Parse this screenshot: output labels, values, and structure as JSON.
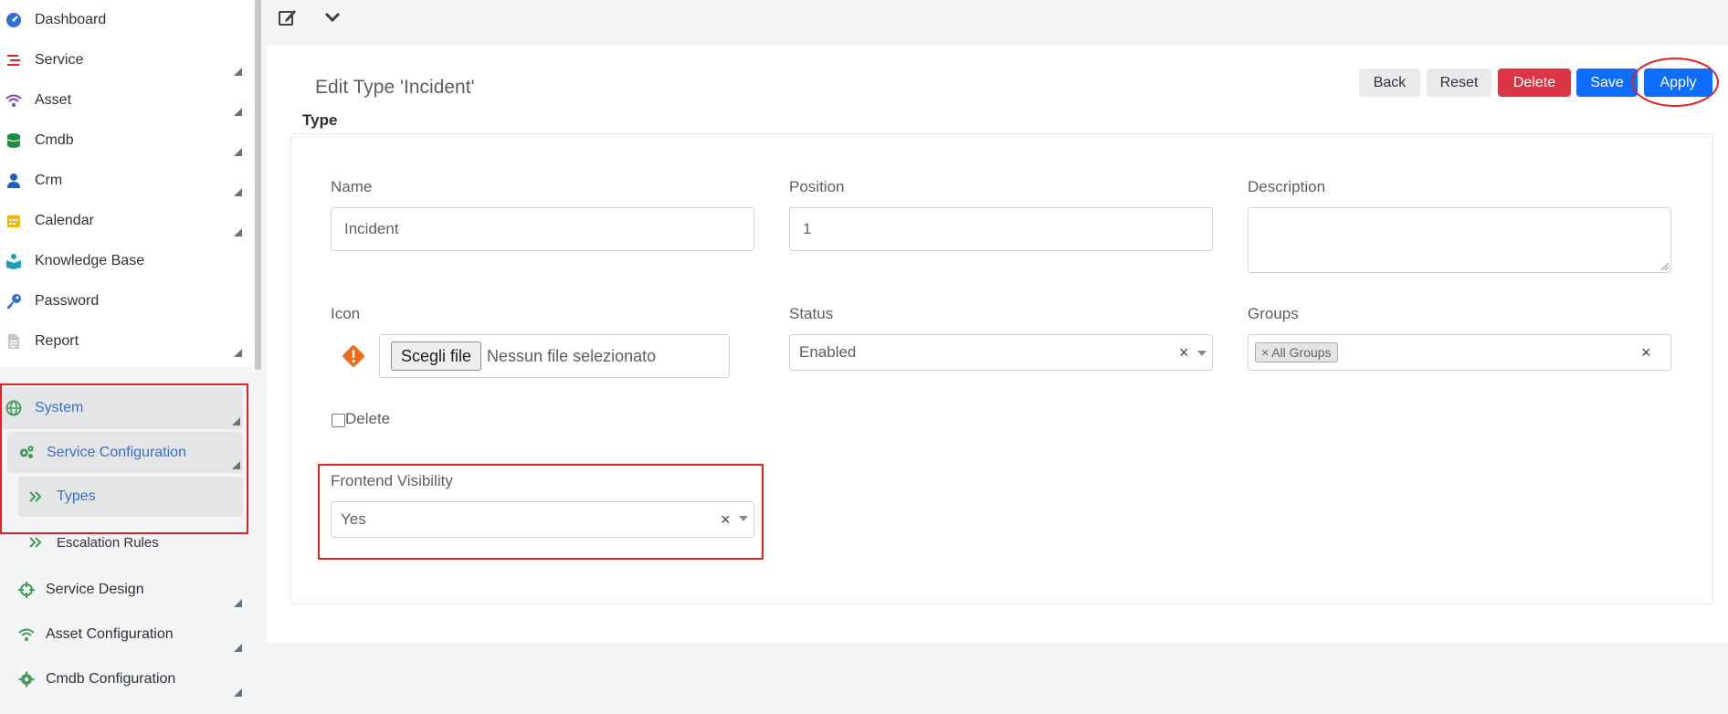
{
  "sidebar": {
    "items": [
      {
        "label": "Dashboard",
        "icon": "gauge-icon",
        "color": "#2f6fd6"
      },
      {
        "label": "Service",
        "icon": "list-icon",
        "color": "#e02424"
      },
      {
        "label": "Asset",
        "icon": "wifi-icon",
        "color": "#7b3fc4"
      },
      {
        "label": "Cmdb",
        "icon": "database-icon",
        "color": "#1e8e3e"
      },
      {
        "label": "Crm",
        "icon": "user-tie-icon",
        "color": "#1f5fbf"
      },
      {
        "label": "Calendar",
        "icon": "calendar-icon",
        "color": "#f5b400"
      },
      {
        "label": "Knowledge Base",
        "icon": "reader-icon",
        "color": "#17a2b8"
      },
      {
        "label": "Password",
        "icon": "key-icon",
        "color": "#2f6fd6"
      },
      {
        "label": "Report",
        "icon": "file-icon",
        "color": "#b0b4b8"
      }
    ],
    "system": {
      "label": "System",
      "icon": "globe-icon"
    },
    "service_configuration": {
      "label": "Service Configuration",
      "icon": "cogs-icon"
    },
    "types": {
      "label": "Types",
      "icon": "double-chevron-right-icon"
    },
    "escalation_rules": {
      "label": "Escalation Rules",
      "icon": "double-chevron-right-icon"
    },
    "service_design": {
      "label": "Service Design",
      "icon": "crosshairs-icon"
    },
    "asset_configuration": {
      "label": "Asset Configuration",
      "icon": "wifi-icon"
    },
    "cmdb_configuration": {
      "label": "Cmdb Configuration",
      "icon": "gear-icon"
    }
  },
  "topbar": {
    "edit_icon": "edit-icon",
    "toggle_icon": "chevron-down-icon"
  },
  "page": {
    "title": "Edit Type 'Incident'",
    "section": "Type"
  },
  "buttons": {
    "back": "Back",
    "reset": "Reset",
    "delete": "Delete",
    "save": "Save",
    "apply": "Apply"
  },
  "form": {
    "name_label": "Name",
    "name_value": "Incident",
    "position_label": "Position",
    "position_value": "1",
    "description_label": "Description",
    "description_value": "",
    "icon_label": "Icon",
    "icon_preview": "warning-icon",
    "file_button": "Scegli file",
    "file_status": "Nessun file selezionato",
    "status_label": "Status",
    "status_value": "Enabled",
    "groups_label": "Groups",
    "groups_tag": "All Groups",
    "delete_checkbox_label": "Delete",
    "frontend_visibility_label": "Frontend Visibility",
    "frontend_visibility_value": "Yes"
  },
  "colors": {
    "accent": "#0d6efd",
    "danger": "#dc3545",
    "highlight": "#e02424",
    "active_text": "#3b6fc7",
    "green_icon": "#3f9b5a"
  }
}
